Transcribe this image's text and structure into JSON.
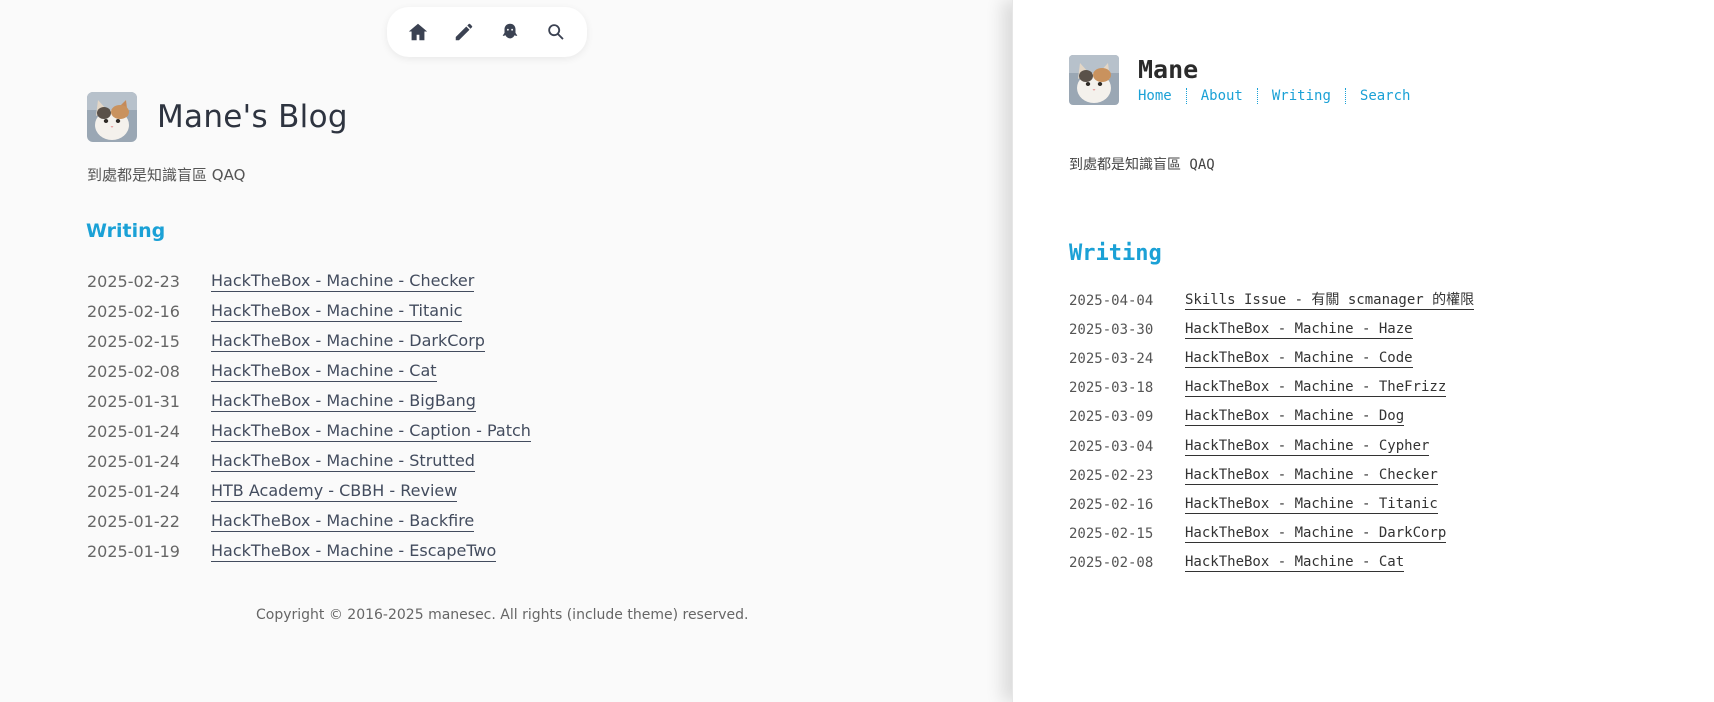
{
  "left": {
    "topnav": [
      {
        "name": "home-icon"
      },
      {
        "name": "pencil-icon"
      },
      {
        "name": "ghost-icon"
      },
      {
        "name": "search-icon"
      }
    ],
    "title": "Mane's Blog",
    "subtitle": "到處都是知識盲區 QAQ",
    "section_title": "Writing",
    "posts": [
      {
        "date": "2025-02-23",
        "title": "HackTheBox - Machine - Checker"
      },
      {
        "date": "2025-02-16",
        "title": "HackTheBox - Machine - Titanic"
      },
      {
        "date": "2025-02-15",
        "title": "HackTheBox - Machine - DarkCorp"
      },
      {
        "date": "2025-02-08",
        "title": "HackTheBox - Machine - Cat"
      },
      {
        "date": "2025-01-31",
        "title": "HackTheBox - Machine - BigBang"
      },
      {
        "date": "2025-01-24",
        "title": "HackTheBox - Machine - Caption - Patch"
      },
      {
        "date": "2025-01-24",
        "title": "HackTheBox - Machine - Strutted"
      },
      {
        "date": "2025-01-24",
        "title": "HTB Academy - CBBH - Review"
      },
      {
        "date": "2025-01-22",
        "title": "HackTheBox - Machine - Backfire"
      },
      {
        "date": "2025-01-19",
        "title": "HackTheBox - Machine - EscapeTwo"
      }
    ],
    "copyright": "Copyright © 2016-2025 manesec. All rights (include theme) reserved."
  },
  "right": {
    "title": "Mane",
    "nav": [
      "Home",
      "About",
      "Writing",
      "Search"
    ],
    "subtitle": "到處都是知識盲區 QAQ",
    "section_title": "Writing",
    "posts": [
      {
        "date": "2025-04-04",
        "title": "Skills Issue - 有關 scmanager 的權限"
      },
      {
        "date": "2025-03-30",
        "title": "HackTheBox - Machine - Haze"
      },
      {
        "date": "2025-03-24",
        "title": "HackTheBox - Machine - Code"
      },
      {
        "date": "2025-03-18",
        "title": "HackTheBox - Machine - TheFrizz"
      },
      {
        "date": "2025-03-09",
        "title": "HackTheBox - Machine - Dog"
      },
      {
        "date": "2025-03-04",
        "title": "HackTheBox - Machine - Cypher"
      },
      {
        "date": "2025-02-23",
        "title": "HackTheBox - Machine - Checker"
      },
      {
        "date": "2025-02-16",
        "title": "HackTheBox - Machine - Titanic"
      },
      {
        "date": "2025-02-15",
        "title": "HackTheBox - Machine - DarkCorp"
      },
      {
        "date": "2025-02-08",
        "title": "HackTheBox - Machine - Cat"
      }
    ]
  },
  "colors": {
    "accent": "#1ba1d6",
    "text": "#434c5e",
    "background": "#fafafa"
  }
}
